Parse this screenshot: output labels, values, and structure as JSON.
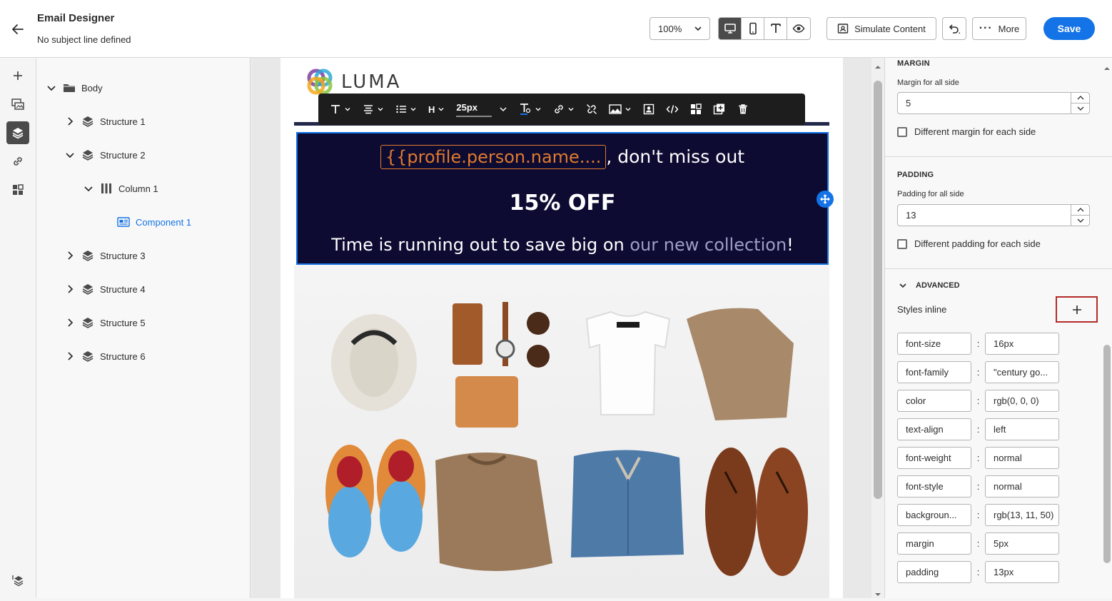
{
  "header": {
    "title": "Email Designer",
    "subtitle": "No subject line defined",
    "zoom": "100%",
    "simulate_label": "Simulate Content",
    "more_label": "More",
    "save_label": "Save"
  },
  "tree": {
    "body_label": "Body",
    "items": [
      {
        "label": "Structure 1"
      },
      {
        "label": "Structure 2"
      },
      {
        "label": "Column 1"
      },
      {
        "label": "Component 1"
      },
      {
        "label": "Structure 3"
      },
      {
        "label": "Structure 4"
      },
      {
        "label": "Structure 5"
      },
      {
        "label": "Structure 6"
      }
    ]
  },
  "email": {
    "logo_text": "LUMA",
    "font_size": "25px",
    "personalization": "{{profile.person.name....",
    "line1_suffix": ", don't miss out",
    "headline": "15% OFF",
    "line3_prefix": "Time is running out to save big on ",
    "line3_link": "our new collection",
    "line3_suffix": "!"
  },
  "props": {
    "margin_title": "MARGIN",
    "margin_label": "Margin for all side",
    "margin_value": "5",
    "margin_diff": "Different margin for each side",
    "padding_title": "PADDING",
    "padding_label": "Padding for all side",
    "padding_value": "13",
    "padding_diff": "Different padding for each side",
    "advanced_title": "ADVANCED",
    "styles_inline": "Styles inline",
    "styles": [
      {
        "key": "font-size",
        "value": "16px"
      },
      {
        "key": "font-family",
        "value": "\"century go..."
      },
      {
        "key": "color",
        "value": "rgb(0, 0, 0)"
      },
      {
        "key": "text-align",
        "value": "left"
      },
      {
        "key": "font-weight",
        "value": "normal"
      },
      {
        "key": "font-style",
        "value": "normal"
      },
      {
        "key": "backgroun...",
        "value": "rgb(13, 11, 50)"
      },
      {
        "key": "margin",
        "value": "5px"
      },
      {
        "key": "padding",
        "value": "13px"
      }
    ]
  },
  "colors": {
    "accent": "#1473e6",
    "hero_bg": "#0d0b32",
    "personalization": "#e07a2c",
    "highlight_border": "#b42b2b"
  }
}
